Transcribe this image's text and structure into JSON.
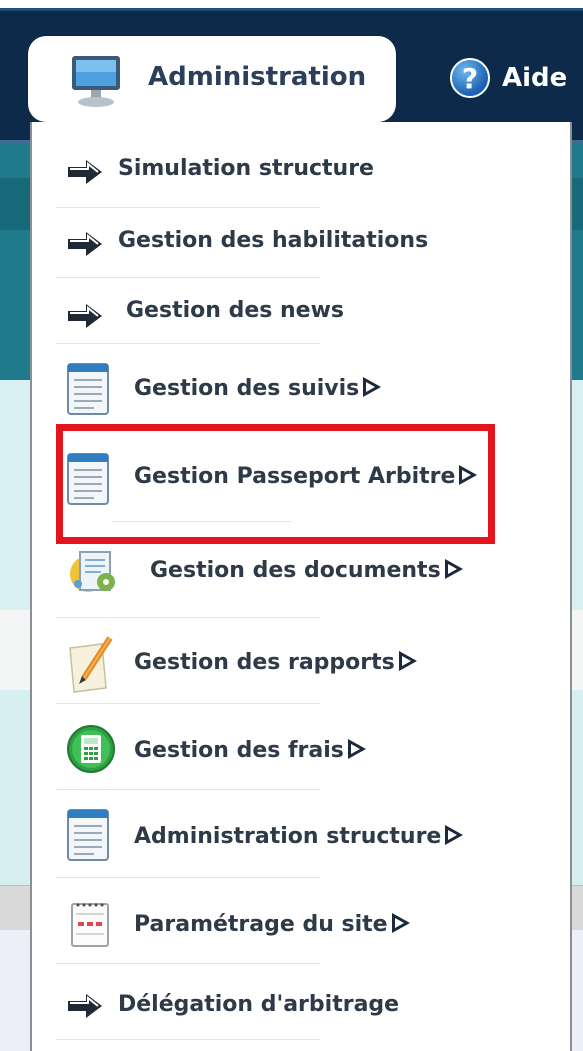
{
  "nav": {
    "admin_tab_label": "Administration",
    "admin_icon": "monitor-icon",
    "help_label": "Aide",
    "help_icon": "help-icon"
  },
  "menu": {
    "items": [
      {
        "label": "Simulation structure",
        "icon": "arrow-right-icon",
        "has_submenu": false
      },
      {
        "label": "Gestion des habilitations",
        "icon": "arrow-right-icon",
        "has_submenu": false
      },
      {
        "label": "Gestion des news",
        "icon": "arrow-right-icon",
        "has_submenu": false
      },
      {
        "label": "Gestion des suivis",
        "icon": "document-icon",
        "has_submenu": true
      },
      {
        "label": "Gestion Passeport Arbitre",
        "icon": "document-icon",
        "has_submenu": true,
        "highlighted": true
      },
      {
        "label": "Gestion des documents",
        "icon": "documents-gear-icon",
        "has_submenu": true
      },
      {
        "label": "Gestion des rapports",
        "icon": "notepad-pencil-icon",
        "has_submenu": true
      },
      {
        "label": "Gestion des frais",
        "icon": "calculator-icon",
        "has_submenu": true
      },
      {
        "label": "Administration structure",
        "icon": "document-icon",
        "has_submenu": true
      },
      {
        "label": "Paramétrage du site",
        "icon": "notepad-icon",
        "has_submenu": true
      },
      {
        "label": "Délégation d'arbitrage",
        "icon": "arrow-right-icon",
        "has_submenu": false
      }
    ]
  },
  "colors": {
    "navbar": "#0d2a4a",
    "highlight": "#e3141d",
    "text": "#2e3a48"
  }
}
